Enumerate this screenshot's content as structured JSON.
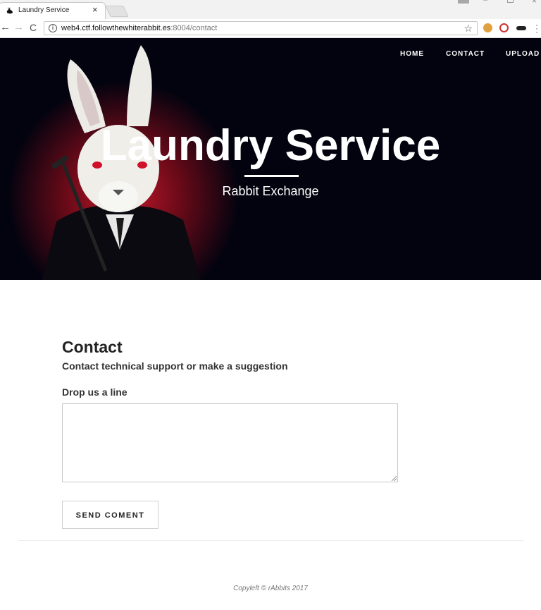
{
  "browser": {
    "tab_title": "Laundry Service",
    "tab_close": "×",
    "url_host": "web4.ctf.followthewhiterabbit.es",
    "url_path": ":8004/contact",
    "back": "←",
    "forward": "→",
    "reload": "C",
    "star": "☆"
  },
  "nav": {
    "home": "HOME",
    "contact": "CONTACT",
    "upload": "UPLOAD"
  },
  "hero": {
    "title": "Laundry Service",
    "subtitle": "Rabbit Exchange"
  },
  "contact": {
    "heading": "Contact",
    "subheading": "Contact technical support or make a suggestion",
    "field_label": "Drop us a line",
    "message_value": "",
    "send_label": "SEND COMENT"
  },
  "footer": {
    "text": "Copyleft © rAbbits 2017"
  },
  "colors": {
    "hero_bg": "#03030f",
    "glow": "#c4182c"
  }
}
